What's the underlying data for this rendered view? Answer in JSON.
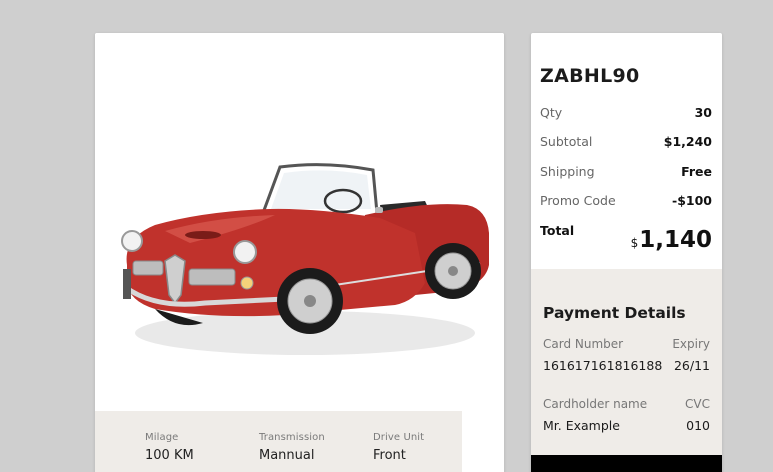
{
  "product": {
    "image_alt": "Red vintage convertible car",
    "specs": [
      {
        "label": "Milage",
        "value": "100 KM"
      },
      {
        "label": "Transmission",
        "value": "Mannual"
      },
      {
        "label": "Drive Unit",
        "value": "Front"
      }
    ]
  },
  "summary": {
    "order_id": "ZABHL90",
    "rows": [
      {
        "label": "Qty",
        "value": "30"
      },
      {
        "label": "Subtotal",
        "value": "$1,240"
      },
      {
        "label": "Shipping",
        "value": "Free"
      },
      {
        "label": "Promo Code",
        "value": "-$100"
      }
    ],
    "total": {
      "label": "Total",
      "currency": "$",
      "amount": "1,140"
    }
  },
  "payment": {
    "title": "Payment Details",
    "card_number_label": "Card Number",
    "card_number": "161617161816188",
    "expiry_label": "Expiry",
    "expiry": "26/11",
    "cardholder_label": "Cardholder name",
    "cardholder": "Mr. Example",
    "cvc_label": "CVC",
    "cvc": "010"
  },
  "colors": {
    "background": "#cfcfcf",
    "panel": "#efece8",
    "car_body": "#c0322c"
  }
}
